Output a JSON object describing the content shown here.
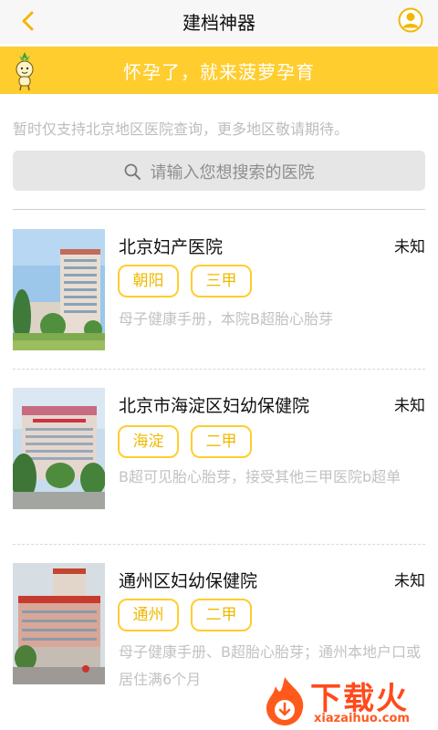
{
  "nav": {
    "title": "建档神器"
  },
  "banner": {
    "slogan": "怀孕了，就来菠萝孕育"
  },
  "notice": "暂时仅支持北京地区医院查询，更多地区敬请期待。",
  "search": {
    "placeholder": "请输入您想搜索的医院"
  },
  "hospitals": [
    {
      "name": "北京妇产医院",
      "status": "未知",
      "tags": [
        "朝阳",
        "三甲"
      ],
      "description": "母子健康手册，本院B超胎心胎芽"
    },
    {
      "name": "北京市海淀区妇幼保健院",
      "status": "未知",
      "tags": [
        "海淀",
        "二甲"
      ],
      "description": "B超可见胎心胎芽，接受其他三甲医院b超单"
    },
    {
      "name": "通州区妇幼保健院",
      "status": "未知",
      "tags": [
        "通州",
        "二甲"
      ],
      "description": "母子健康手册、B超胎心胎芽；通州本地户口或居住满6个月"
    }
  ],
  "watermark": {
    "text": "下载火",
    "url": "xiazaihuo.com"
  },
  "colors": {
    "accent": "#ffcd2e",
    "tag_text": "#f0b800",
    "watermark": "#ff4a1c"
  }
}
